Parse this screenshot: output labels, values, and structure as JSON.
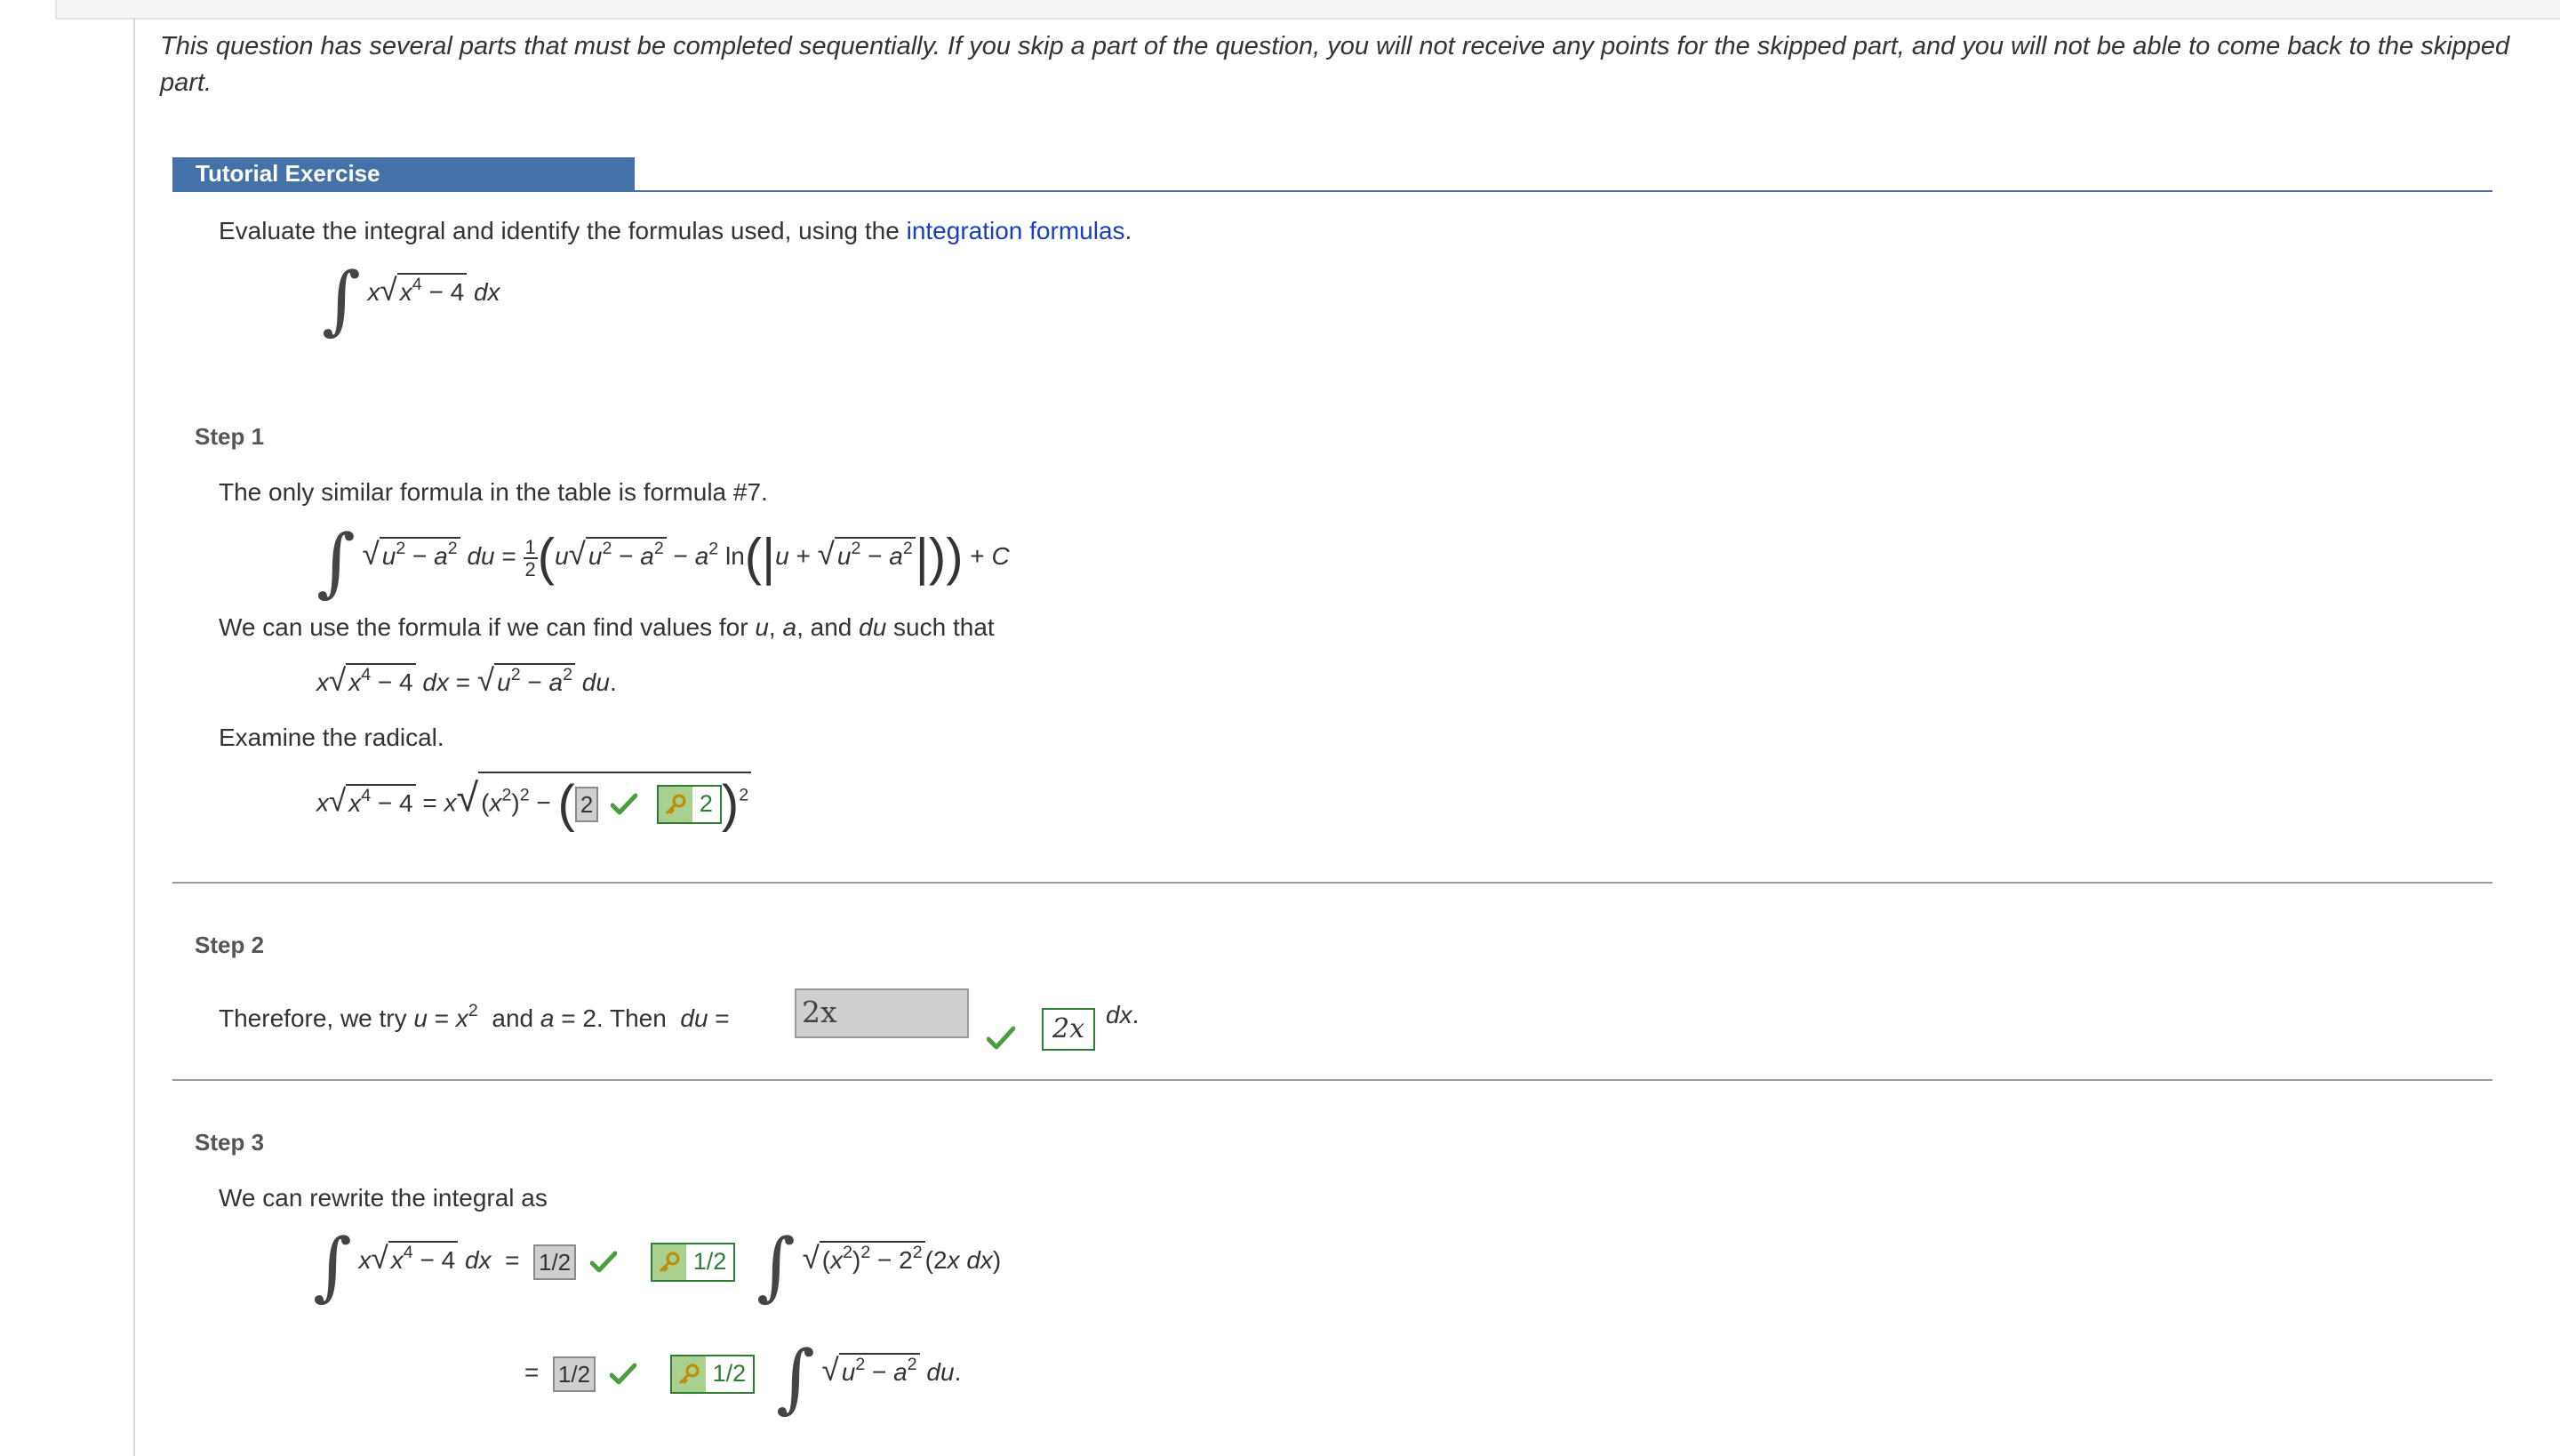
{
  "intro": "This question has several parts that must be completed sequentially. If you skip a part of the question, you will not receive any points for the skipped part, and you will not be able to come back to the skipped part.",
  "tutorial_label": "Tutorial Exercise",
  "prompt_text": "Evaluate the integral and identify the formulas used, using the ",
  "prompt_link": "integration formulas",
  "prompt_end": ".",
  "steps": {
    "s1": {
      "label": "Step 1",
      "line1": "The only similar formula in the table is formula #7.",
      "line2a": "We can use the formula if we can find values for ",
      "line2b": " such that",
      "line3": "Examine the radical.",
      "answer_entered": "2",
      "answer_correct": "2"
    },
    "s2": {
      "label": "Step 2",
      "text_a": "Therefore, we try ",
      "answer_entered": "2x",
      "answer_correct": "2x"
    },
    "s3": {
      "label": "Step 3",
      "line1": "We can rewrite the integral as",
      "answer1_entered": "1/2",
      "answer1_correct": "1/2",
      "answer2_entered": "1/2",
      "answer2_correct": "1/2"
    }
  },
  "colors": {
    "tutorial_bar": "#4472a8",
    "link": "#1a3fb8",
    "correct": "#2e7d32",
    "check": "#4a9e3f",
    "field": "#cfcfcf"
  },
  "icons": [
    "checkmark-icon",
    "key-icon"
  ]
}
